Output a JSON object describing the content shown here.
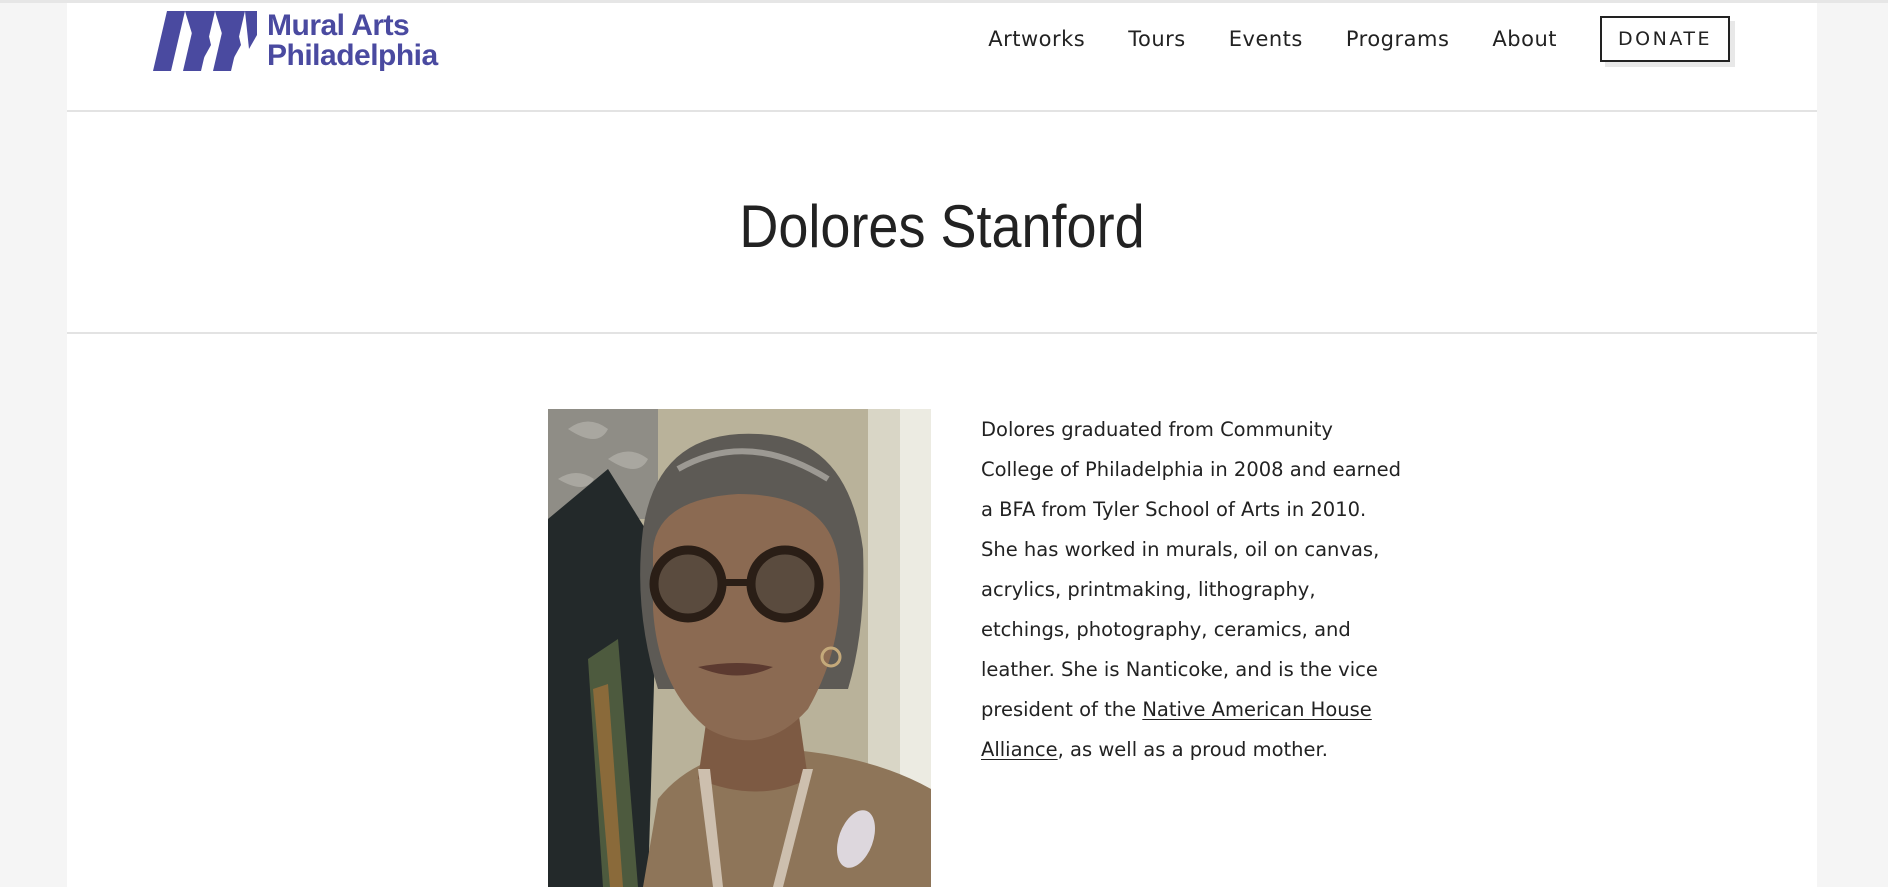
{
  "header": {
    "logo": {
      "line1": "Mural Arts",
      "line2": "Philadelphia",
      "color": "#4a4aa0"
    },
    "nav": [
      {
        "label": "Artworks"
      },
      {
        "label": "Tours"
      },
      {
        "label": "Events"
      },
      {
        "label": "Programs"
      },
      {
        "label": "About"
      }
    ],
    "donate_label": "DONATE"
  },
  "page": {
    "title": "Dolores Stanford"
  },
  "bio": {
    "text_before_link": "Dolores graduated from Community College of Philadelphia in 2008 and earned a BFA from Tyler School of Arts in 2010. She has worked in murals, oil on canvas, acrylics, printmaking, lithography, etchings, photography, ceramics, and leather. She is Nanticoke, and is the vice president of the ",
    "link_text": "Native American House Alliance",
    "text_after_link": ", as well as a proud mother."
  }
}
